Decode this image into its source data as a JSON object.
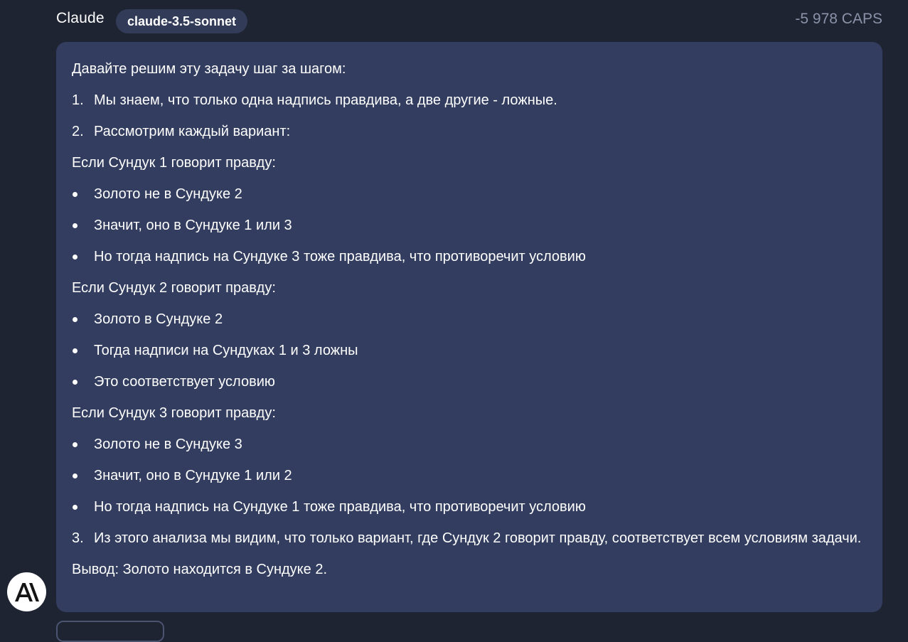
{
  "header": {
    "sender": "Claude",
    "model": "claude-3.5-sonnet",
    "caps": "-5 978 CAPS"
  },
  "message": {
    "intro": "Давайте решим эту задачу шаг за шагом:",
    "step1": {
      "num": "1.",
      "text": "Мы знаем, что только одна надпись правдива, а две другие - ложные."
    },
    "step2": {
      "num": "2.",
      "text": "Рассмотрим каждый вариант:"
    },
    "case1": {
      "title": "Если Сундук 1 говорит правду:",
      "items": [
        "Золото не в Сундуке 2",
        "Значит, оно в Сундуке 1 или 3",
        "Но тогда надпись на Сундуке 3 тоже правдива, что противоречит условию"
      ]
    },
    "case2": {
      "title": "Если Сундук 2 говорит правду:",
      "items": [
        "Золото в Сундуке 2",
        "Тогда надписи на Сундуках 1 и 3 ложны",
        "Это соответствует условию"
      ]
    },
    "case3": {
      "title": "Если Сундук 3 говорит правду:",
      "items": [
        "Золото не в Сундуке 3",
        "Значит, оно в Сундуке 1 или 2",
        "Но тогда надпись на Сундуке 1 тоже правдива, что противоречит условию"
      ]
    },
    "step3": {
      "num": "3.",
      "text": "Из этого анализа мы видим, что только вариант, где Сундук 2 говорит правду, соответствует всем условиям задачи."
    },
    "conclusion": "Вывод: Золото находится в Сундуке 2."
  },
  "avatar": {
    "icon": "anthropic-logo-icon"
  },
  "colors": {
    "background": "#1e2432",
    "bubble": "#323d5f",
    "badge": "#323c58",
    "caps": "#8a93a8"
  }
}
